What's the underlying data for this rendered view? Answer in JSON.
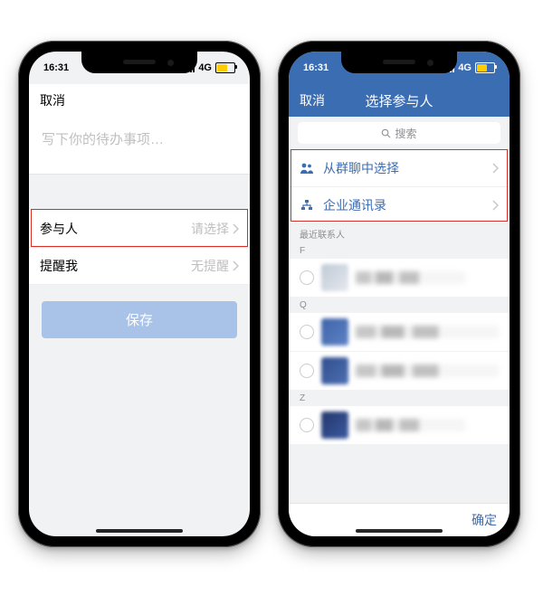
{
  "statusbar": {
    "time": "16:31",
    "net": "4G"
  },
  "left": {
    "nav_cancel": "取消",
    "todo_placeholder": "写下你的待办事项…",
    "participant_label": "参与人",
    "participant_value": "请选择",
    "remind_label": "提醒我",
    "remind_value": "无提醒",
    "save_label": "保存"
  },
  "right": {
    "nav_cancel": "取消",
    "nav_title": "选择参与人",
    "search_placeholder": "搜索",
    "option_group": "从群聊中选择",
    "option_contacts": "企业通讯录",
    "recent_header": "最近联系人",
    "letters": [
      "F",
      "Q",
      "Z"
    ],
    "confirm_label": "确定"
  }
}
